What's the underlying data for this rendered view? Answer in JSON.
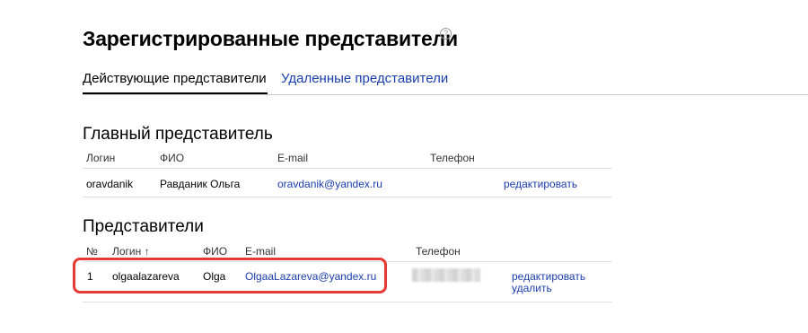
{
  "page": {
    "title": "Зарегистрированные представители",
    "help_symbol": "?"
  },
  "tabs": [
    {
      "label": "Действующие представители",
      "active": true
    },
    {
      "label": "Удаленные представители",
      "active": false
    }
  ],
  "main_rep": {
    "heading": "Главный представитель",
    "columns": [
      "Логин",
      "ФИО",
      "E-mail",
      "Телефон"
    ],
    "row": {
      "login": "oravdanik",
      "name": "Равданик Ольга",
      "email": "oravdanik@yandex.ru",
      "phone": "",
      "action": "редактировать"
    }
  },
  "reps": {
    "heading": "Представители",
    "columns": [
      "№",
      "Логин ↑",
      "ФИО",
      "E-mail",
      "Телефон"
    ],
    "rows": [
      {
        "num": "1",
        "login": "olgaalazareva",
        "name": "Olga",
        "email": "OlgaaLazareva@yandex.ru",
        "phone_obscured": true,
        "action_edit": "редактировать",
        "action_delete": "удалить"
      }
    ]
  },
  "colors": {
    "link": "#1a3dad",
    "highlight": "#e53935",
    "tab_active_underline": "#000000"
  }
}
